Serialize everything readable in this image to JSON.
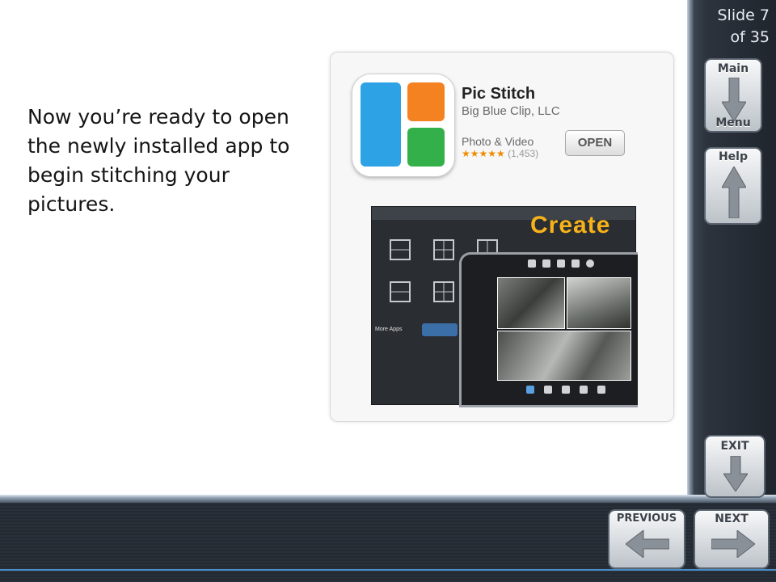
{
  "slide": {
    "counter_line1": "Slide 7",
    "counter_line2": "of 35",
    "main_text": "Now you’re ready to open the newly installed app to begin stitching your pictures."
  },
  "nav": {
    "main_top": "Main",
    "main_bottom": "Menu",
    "help": "Help",
    "exit": "EXIT",
    "previous": "PREVIOUS",
    "next": "NEXT"
  },
  "app_store": {
    "app_name": "Pic Stitch",
    "developer": "Big Blue Clip, LLC",
    "category": "Photo & Video",
    "stars": "★★★★★",
    "rating_count": "(1,453)",
    "open_label": "OPEN"
  },
  "preview": {
    "create_label": "Create",
    "more_apps": "More Apps"
  },
  "colors": {
    "tile_blue": "#2da3e6",
    "tile_orange": "#f58220",
    "tile_green": "#33b04a",
    "create_yellow": "#f5b21a",
    "accent_line": "#4a8fc9"
  }
}
